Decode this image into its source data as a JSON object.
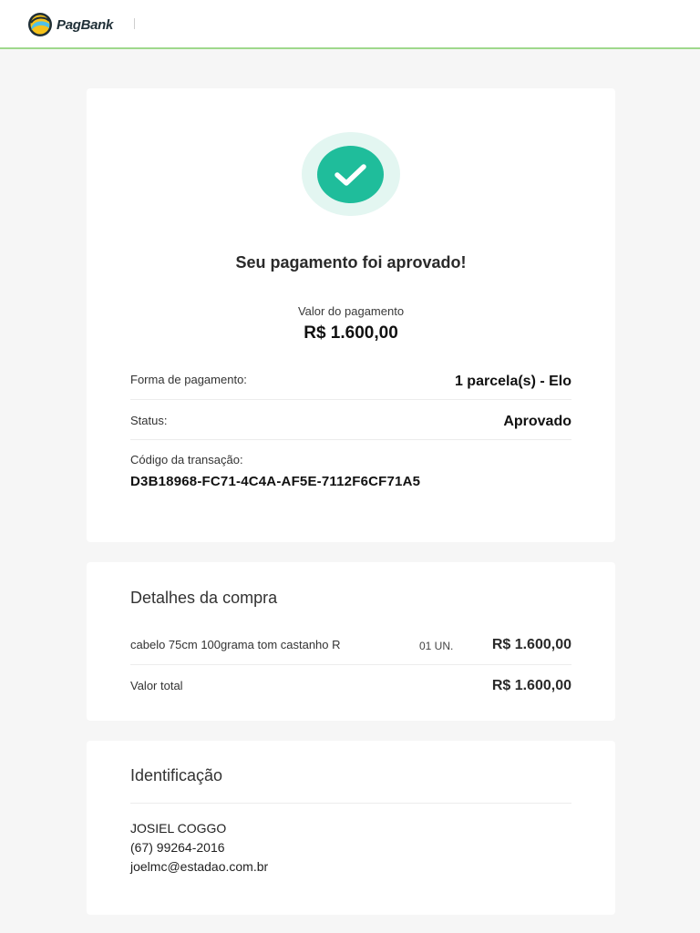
{
  "header": {
    "brand": "PagBank",
    "logo_icon": "pagbank-logo-icon"
  },
  "payment": {
    "status_icon": "check-icon",
    "title": "Seu pagamento foi aprovado!",
    "amount_label": "Valor do pagamento",
    "amount_value": "R$ 1.600,00",
    "method_label": "Forma de pagamento:",
    "method_value": "1 parcela(s) - Elo",
    "status_label": "Status:",
    "status_value": "Aprovado",
    "code_label": "Código da transação:",
    "code_value": "D3B18968-FC71-4C4A-AF5E-7112F6CF71A5"
  },
  "purchase": {
    "title": "Detalhes da compra",
    "items": [
      {
        "name": "cabelo 75cm 100grama tom castanho R",
        "quantity": "01 UN.",
        "price": "R$ 1.600,00"
      }
    ],
    "total_label": "Valor total",
    "total_value": "R$ 1.600,00"
  },
  "identification": {
    "title": "Identificação",
    "name": "JOSIEL COGGO",
    "phone": "(67) 99264-2016",
    "email": "joelmc@estadao.com.br"
  },
  "colors": {
    "accent": "#1fbd9b",
    "accent_light": "#e3f6f1",
    "header_border": "#9fd88c",
    "page_background": "#f6f6f6"
  }
}
